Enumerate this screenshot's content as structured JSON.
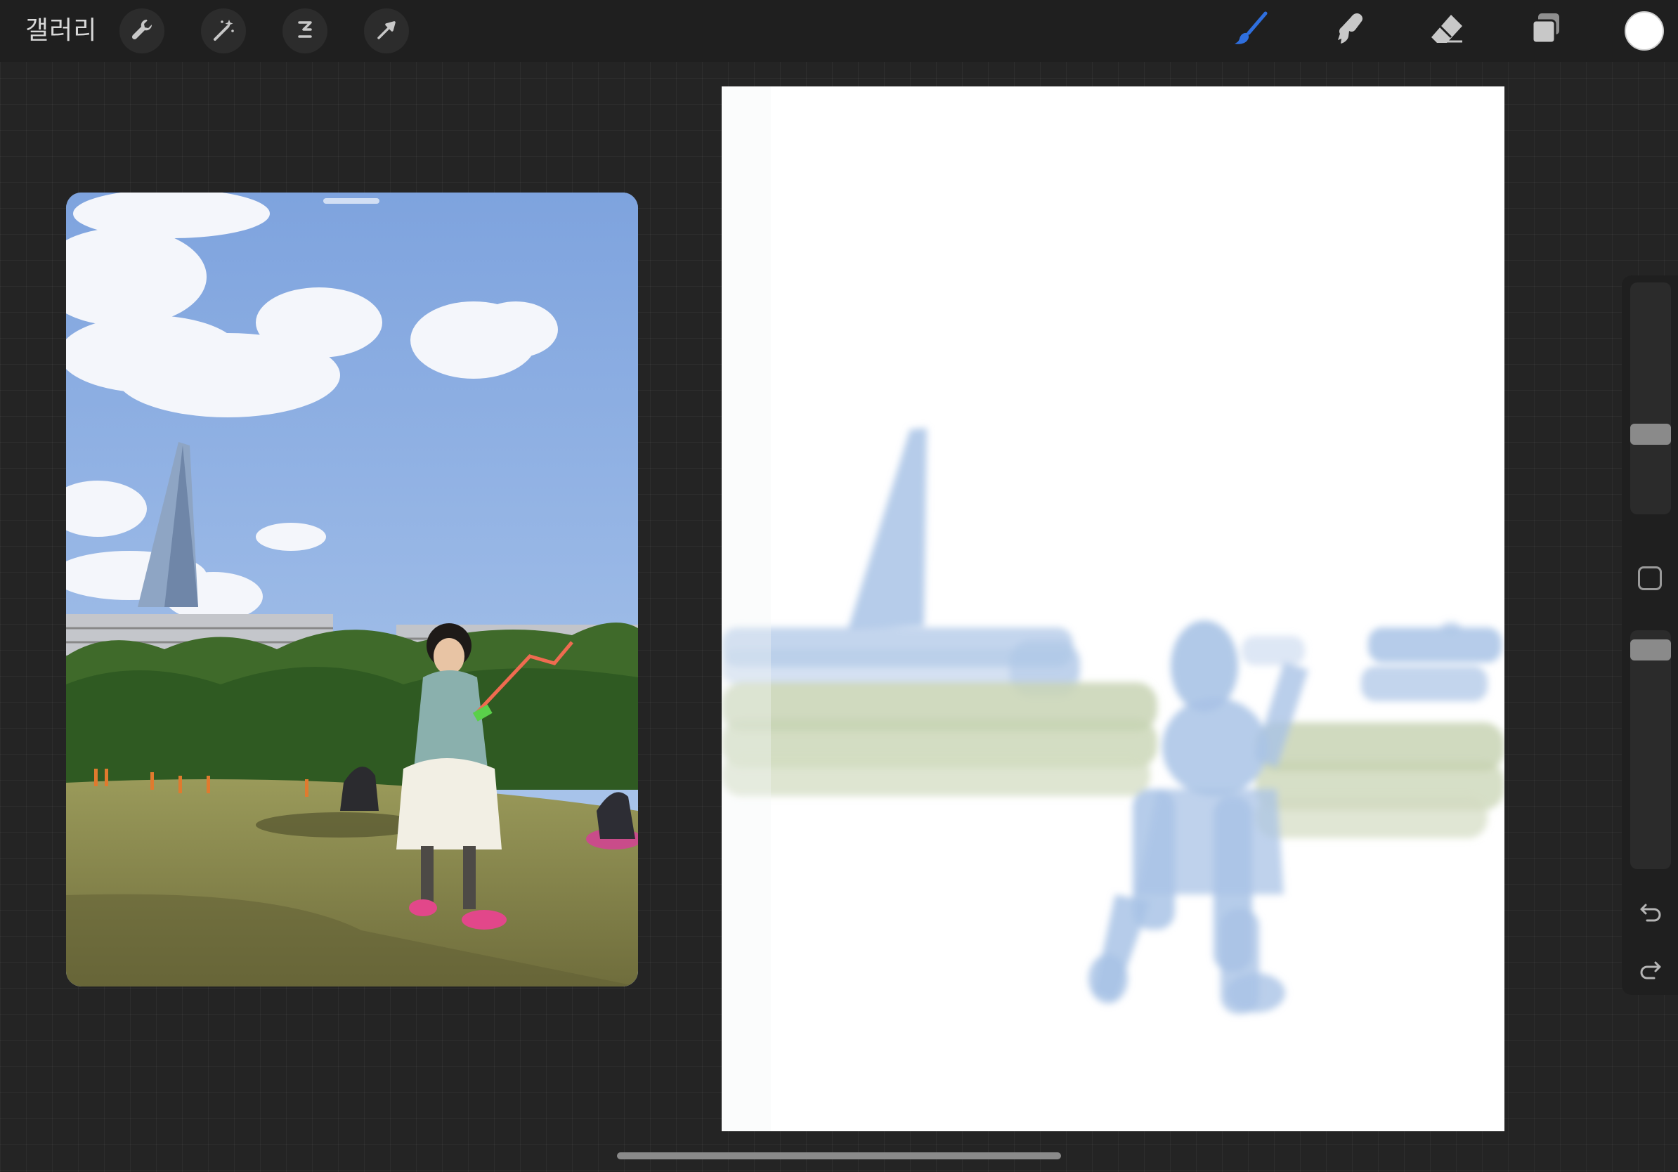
{
  "toolbar": {
    "gallery_label": "갤러리",
    "left_tools": [
      "wrench-icon",
      "magic-wand-icon",
      "selection-icon",
      "transform-arrow-icon"
    ],
    "right_tools": [
      "brush-icon",
      "smudge-icon",
      "eraser-icon",
      "layers-icon"
    ],
    "active_tool": "brush-icon",
    "active_color": "#2f6fde",
    "current_color": "#ffffff"
  },
  "sidebar": {
    "size_slider_value": 0.43,
    "opacity_slider_value": 0.02,
    "buttons": [
      "modify-button",
      "undo-icon",
      "redo-icon"
    ]
  },
  "reference": {
    "content": "photo"
  },
  "colors": {
    "stroke_blue": "#a9c3e6",
    "stroke_green": "#c8d4b4",
    "background": "#242424"
  }
}
